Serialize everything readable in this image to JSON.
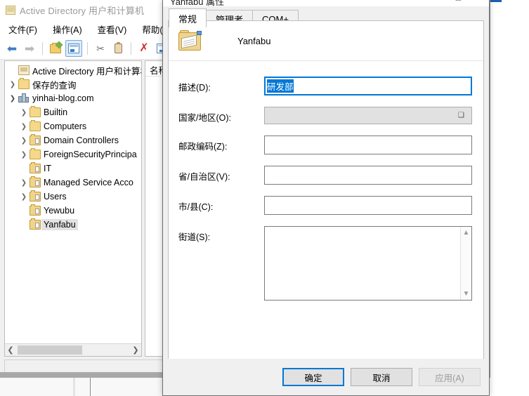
{
  "main_window": {
    "title": "Active Directory 用户和计算机",
    "title_icon": "console-icon",
    "menus": [
      {
        "label": "文件(F)"
      },
      {
        "label": "操作(A)"
      },
      {
        "label": "查看(V)"
      },
      {
        "label": "帮助(H)"
      }
    ],
    "toolbar": [
      {
        "name": "back-arrow-icon",
        "glyph": "←"
      },
      {
        "name": "forward-arrow-icon",
        "glyph": "→"
      },
      {
        "name": "up-folder-icon",
        "glyph": ""
      },
      {
        "name": "properties-icon",
        "glyph": ""
      },
      {
        "name": "cut-icon",
        "glyph": "✂"
      },
      {
        "name": "paste-icon",
        "glyph": ""
      },
      {
        "name": "delete-icon",
        "glyph": "✖"
      },
      {
        "name": "properties-window-icon",
        "glyph": ""
      },
      {
        "name": "refresh-icon",
        "glyph": "↻"
      }
    ],
    "tree": [
      {
        "label": "Active Directory 用户和计算机",
        "icon": "console",
        "indent": 0,
        "chevron": "none",
        "selected": false
      },
      {
        "label": "保存的查询",
        "icon": "folder",
        "indent": 1,
        "chevron": "collapsed",
        "selected": false
      },
      {
        "label": "yinhai-blog.com",
        "icon": "domain",
        "indent": 1,
        "chevron": "expanded",
        "selected": false
      },
      {
        "label": "Builtin",
        "icon": "folder",
        "indent": 2,
        "chevron": "collapsed",
        "selected": false
      },
      {
        "label": "Computers",
        "icon": "folder",
        "indent": 2,
        "chevron": "collapsed",
        "selected": false
      },
      {
        "label": "Domain Controllers",
        "icon": "ou",
        "indent": 2,
        "chevron": "collapsed",
        "selected": false
      },
      {
        "label": "ForeignSecurityPrincipa",
        "icon": "folder",
        "indent": 2,
        "chevron": "collapsed",
        "selected": false
      },
      {
        "label": "IT",
        "icon": "ou",
        "indent": 2,
        "chevron": "none",
        "selected": false
      },
      {
        "label": "Managed Service Acco",
        "icon": "ou",
        "indent": 2,
        "chevron": "collapsed",
        "selected": false
      },
      {
        "label": "Users",
        "icon": "ou",
        "indent": 2,
        "chevron": "collapsed",
        "selected": false
      },
      {
        "label": "Yewubu",
        "icon": "ou",
        "indent": 2,
        "chevron": "none",
        "selected": false
      },
      {
        "label": "Yanfabu",
        "icon": "ou",
        "indent": 2,
        "chevron": "none",
        "selected": true
      }
    ],
    "list_columns": [
      "名称"
    ],
    "list_rows": []
  },
  "dialog": {
    "title": "Yanfabu 属性",
    "minimize_glyph": "–",
    "maximize_glyph": "□",
    "tabs": [
      {
        "label": "常规",
        "active": true
      },
      {
        "label": "管理者",
        "active": false
      },
      {
        "label": "COM+",
        "active": false
      }
    ],
    "object_name": "Yanfabu",
    "object_icon": "ou-folder-icon",
    "fields": [
      {
        "label": "描述(D):",
        "value": "研发部",
        "type": "text",
        "focused": true,
        "selected": true
      },
      {
        "label": "国家/地区(O):",
        "value": "",
        "type": "combo",
        "focused": false
      },
      {
        "label": "邮政编码(Z):",
        "value": "",
        "type": "text",
        "focused": false
      },
      {
        "label": "省/自治区(V):",
        "value": "",
        "type": "text",
        "focused": false
      },
      {
        "label": "市/县(C):",
        "value": "",
        "type": "text",
        "focused": false
      },
      {
        "label": "街道(S):",
        "value": "",
        "type": "textarea",
        "focused": false
      }
    ],
    "buttons": [
      {
        "label": "确定",
        "style": "default"
      },
      {
        "label": "取消",
        "style": "normal"
      },
      {
        "label": "应用(A)",
        "style": "disabled"
      }
    ]
  },
  "background_window": {
    "close_glyph": "✕"
  },
  "colors": {
    "accent": "#0078d7",
    "selection": "#0078d7",
    "dialog_bg": "#f0f0f0",
    "window_bg": "#ffffff",
    "folder": "#f3d487",
    "delete_red": "#d12c2c"
  }
}
